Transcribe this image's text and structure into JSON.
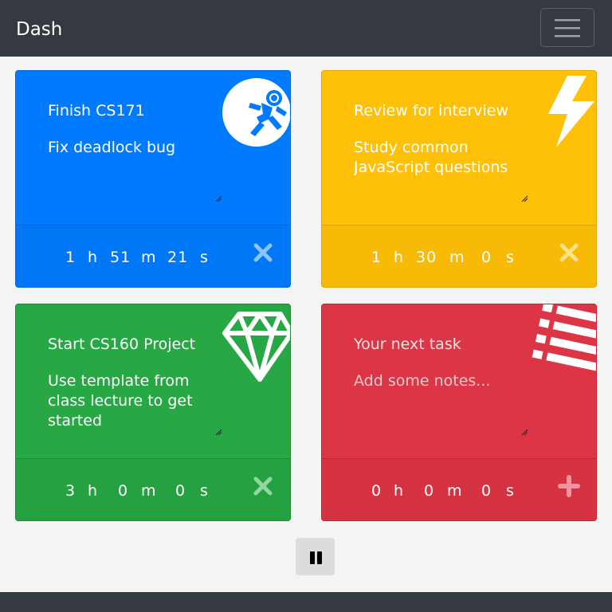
{
  "navbar": {
    "brand": "Dash",
    "menu_icon": "hamburger-menu-icon"
  },
  "cards": [
    {
      "color": "#007bff",
      "icon": "astronaut-icon",
      "title": "Finish CS171",
      "notes": "Fix deadlock bug",
      "placeholder": "",
      "timer": {
        "h": "1",
        "h_unit": "h",
        "m": "51",
        "m_unit": "m",
        "s": "21",
        "s_unit": "s"
      },
      "action_icon": "close-icon"
    },
    {
      "color": "#ffc107",
      "icon": "lightning-bolt-icon",
      "title": "Review for interview",
      "notes": "Study common JavaScript questions",
      "placeholder": "",
      "timer": {
        "h": "1",
        "h_unit": "h",
        "m": "30",
        "m_unit": "m",
        "s": "0",
        "s_unit": "s"
      },
      "action_icon": "close-icon"
    },
    {
      "color": "#28a745",
      "icon": "diamond-icon",
      "title": "Start CS160 Project",
      "notes": "Use template from class lecture to get started",
      "placeholder": "",
      "timer": {
        "h": "3",
        "h_unit": "h",
        "m": "0",
        "m_unit": "m",
        "s": "0",
        "s_unit": "s"
      },
      "action_icon": "close-icon"
    },
    {
      "color": "#dc3545",
      "icon": "list-icon",
      "title": "Your next task",
      "notes": "",
      "placeholder": "Add some notes...",
      "timer": {
        "h": "0",
        "h_unit": "h",
        "m": "0",
        "m_unit": "m",
        "s": "0",
        "s_unit": "s"
      },
      "action_icon": "plus-icon"
    }
  ],
  "controls": {
    "pause_icon": "pause-icon"
  }
}
